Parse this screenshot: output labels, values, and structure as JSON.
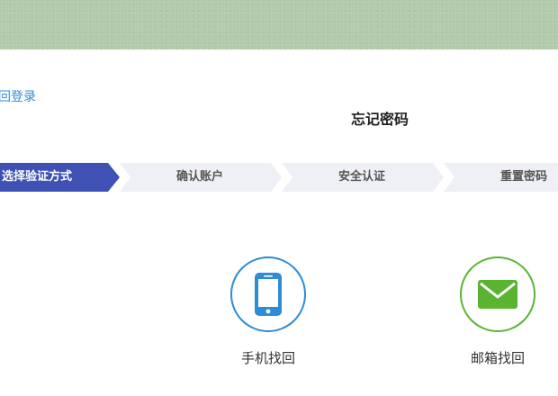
{
  "header": {
    "back_link": "回登录"
  },
  "page": {
    "title": "忘记密码"
  },
  "steps": [
    {
      "label": "选择验证方式",
      "active": true
    },
    {
      "label": "确认账户",
      "active": false
    },
    {
      "label": "安全认证",
      "active": false
    },
    {
      "label": "重置密码",
      "active": false
    }
  ],
  "options": [
    {
      "label": "手机找回",
      "icon": "phone-icon",
      "color": "#2d8cd5"
    },
    {
      "label": "邮箱找回",
      "icon": "mail-icon",
      "color": "#5ab432"
    }
  ],
  "colors": {
    "banner": "#b3cbab",
    "active_step": "#3f51b5",
    "inactive_step": "#eff0f6",
    "link": "#2d8cd5"
  }
}
